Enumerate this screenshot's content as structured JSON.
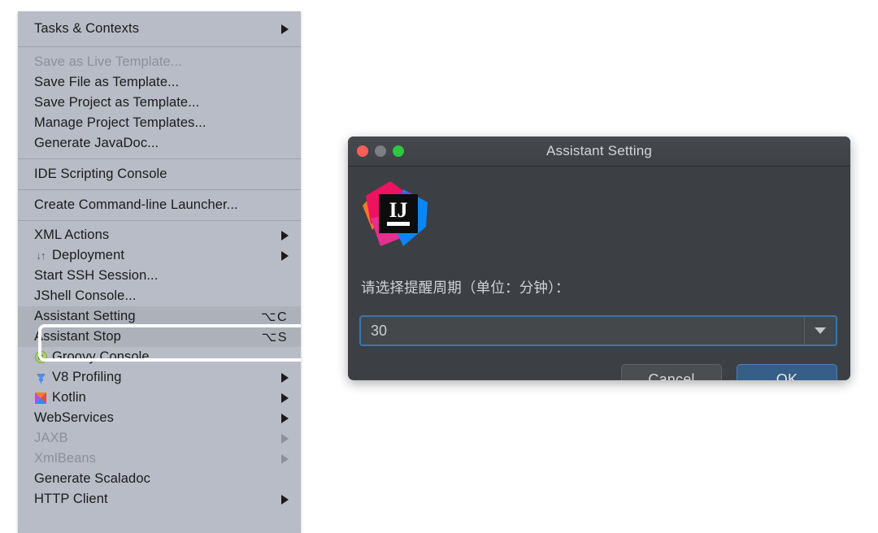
{
  "menu": {
    "groups": [
      {
        "id": "tasks",
        "items": [
          {
            "label": "Tasks & Contexts",
            "submenu": true,
            "disabled": false,
            "icon": "",
            "shortcut": "",
            "size": "tall"
          }
        ]
      },
      {
        "id": "templates",
        "items": [
          {
            "label": "Save as Live Template...",
            "submenu": false,
            "disabled": true,
            "icon": "",
            "shortcut": "",
            "size": "normal"
          },
          {
            "label": "Save File as Template...",
            "submenu": false,
            "disabled": false,
            "icon": "",
            "shortcut": "",
            "size": "normal"
          },
          {
            "label": "Save Project as Template...",
            "submenu": false,
            "disabled": false,
            "icon": "",
            "shortcut": "",
            "size": "normal"
          },
          {
            "label": "Manage Project Templates...",
            "submenu": false,
            "disabled": false,
            "icon": "",
            "shortcut": "",
            "size": "normal"
          },
          {
            "label": "Generate JavaDoc...",
            "submenu": false,
            "disabled": false,
            "icon": "",
            "shortcut": "",
            "size": "normal"
          }
        ]
      },
      {
        "id": "scripting",
        "items": [
          {
            "label": "IDE Scripting Console",
            "submenu": false,
            "disabled": false,
            "icon": "",
            "shortcut": "",
            "size": "midtall"
          }
        ]
      },
      {
        "id": "launcher",
        "items": [
          {
            "label": "Create Command-line Launcher...",
            "submenu": false,
            "disabled": false,
            "icon": "",
            "shortcut": "",
            "size": "midtall"
          }
        ]
      },
      {
        "id": "tools",
        "items": [
          {
            "label": "XML Actions",
            "submenu": true,
            "disabled": false,
            "icon": "",
            "shortcut": "",
            "size": "normal"
          },
          {
            "label": "Deployment",
            "submenu": true,
            "disabled": false,
            "icon": "deployment-icon",
            "shortcut": "",
            "size": "normal"
          },
          {
            "label": "Start SSH Session...",
            "submenu": false,
            "disabled": false,
            "icon": "",
            "shortcut": "",
            "size": "normal"
          },
          {
            "label": "JShell Console...",
            "submenu": false,
            "disabled": false,
            "icon": "",
            "shortcut": "",
            "size": "normal"
          },
          {
            "label": "Assistant Setting",
            "submenu": false,
            "disabled": false,
            "icon": "",
            "shortcut": "⌥C",
            "size": "normal",
            "highlighted": true
          },
          {
            "label": "Assistant Stop",
            "submenu": false,
            "disabled": false,
            "icon": "",
            "shortcut": "⌥S",
            "size": "normal",
            "highlighted": true
          },
          {
            "label": "Groovy Console",
            "submenu": false,
            "disabled": false,
            "icon": "groovy-icon",
            "shortcut": "",
            "size": "normal"
          },
          {
            "label": "V8 Profiling",
            "submenu": true,
            "disabled": false,
            "icon": "v8-icon",
            "shortcut": "",
            "size": "normal"
          },
          {
            "label": "Kotlin",
            "submenu": true,
            "disabled": false,
            "icon": "kotlin-icon",
            "shortcut": "",
            "size": "normal"
          },
          {
            "label": "WebServices",
            "submenu": true,
            "disabled": false,
            "icon": "",
            "shortcut": "",
            "size": "normal"
          },
          {
            "label": "JAXB",
            "submenu": true,
            "disabled": true,
            "icon": "",
            "shortcut": "",
            "size": "normal"
          },
          {
            "label": "XmlBeans",
            "submenu": true,
            "disabled": true,
            "icon": "",
            "shortcut": "",
            "size": "normal"
          },
          {
            "label": "Generate Scaladoc",
            "submenu": false,
            "disabled": false,
            "icon": "",
            "shortcut": "",
            "size": "normal"
          },
          {
            "label": "HTTP Client",
            "submenu": true,
            "disabled": false,
            "icon": "",
            "shortcut": "",
            "size": "normal"
          }
        ]
      }
    ],
    "icon_glyphs": {
      "deployment-icon": "↓↑",
      "groovy-icon": "G"
    }
  },
  "dialog": {
    "title": "Assistant Setting",
    "logo_name": "intellij-idea-logo",
    "logo_text_top": "IJ",
    "traffic_lights": {
      "close": "close-button",
      "minimize": "minimize-button",
      "zoom": "zoom-button"
    },
    "field_label": "请选择提醒周期（单位：分钟）：",
    "combo": {
      "value": "30",
      "options": [
        "30"
      ]
    },
    "buttons": {
      "cancel": "Cancel",
      "ok": "OK"
    }
  },
  "colors": {
    "menu_bg": "#b8bcc6",
    "menu_sep": "#9da2ad",
    "menu_text": "#1b1b1b",
    "menu_text_disabled": "#8c909b",
    "highlight_ring": "#ffffff",
    "dialog_bg": "#3c4044",
    "titlebar_bg": "#414448",
    "accent_blue": "#3c74ad",
    "primary_button": "#355f88",
    "traffic_red": "#fc5f57",
    "traffic_gray": "#7b7e82",
    "traffic_green": "#2bc840"
  }
}
